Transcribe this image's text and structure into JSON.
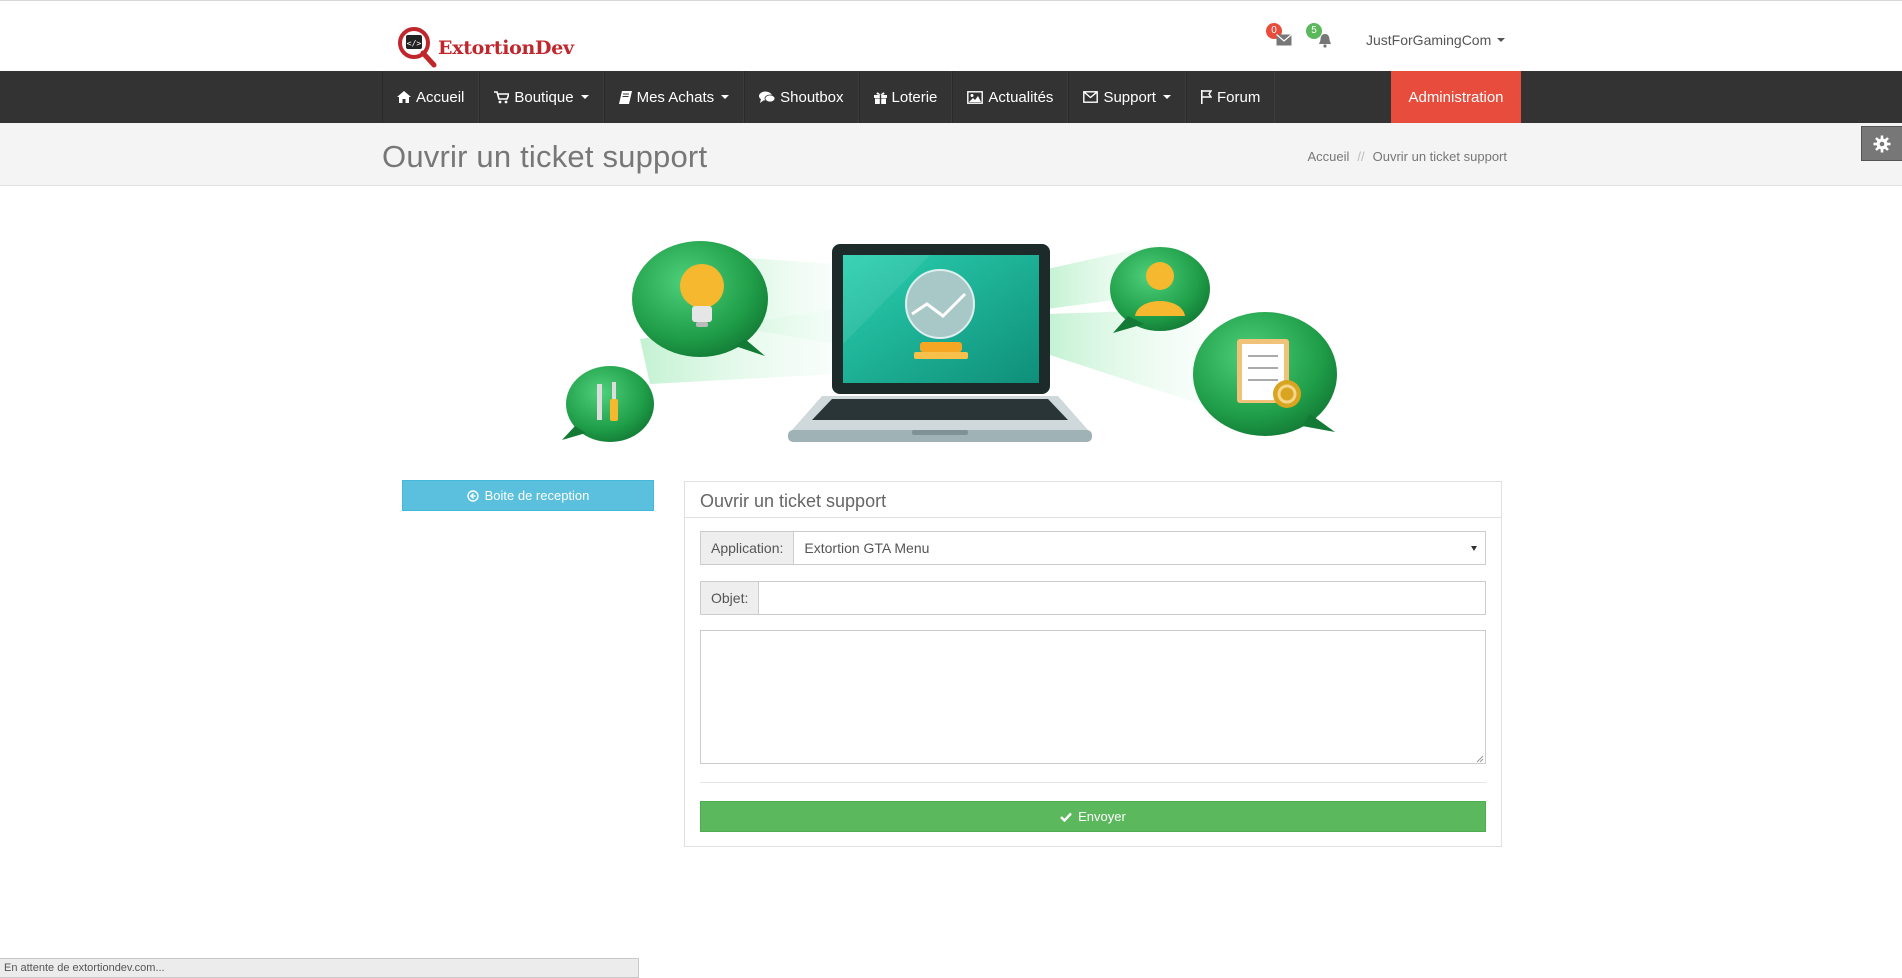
{
  "brand": {
    "name": "ExtortionDev",
    "accent": "#c0272d"
  },
  "header": {
    "mail_count": "0",
    "notif_count": "5",
    "user_name": "JustForGamingCom"
  },
  "nav": {
    "items": [
      {
        "label": "Accueil",
        "icon": "home-icon"
      },
      {
        "label": "Boutique",
        "icon": "cart-icon"
      },
      {
        "label": "Mes Achats",
        "icon": "book-icon"
      },
      {
        "label": "Shoutbox",
        "icon": "comments-icon"
      },
      {
        "label": "Loterie",
        "icon": "gift-icon"
      },
      {
        "label": "Actualités",
        "icon": "picture-icon"
      },
      {
        "label": "Support",
        "icon": "envelope-icon"
      },
      {
        "label": "Forum",
        "icon": "flag-icon"
      }
    ],
    "admin_label": "Administration",
    "admin_color": "#e74c3c"
  },
  "page": {
    "title": "Ouvrir un ticket support",
    "breadcrumb": {
      "home": "Accueil",
      "separator": "//",
      "current": "Ouvrir un ticket support"
    }
  },
  "sidebar": {
    "inbox_label": "Boite de reception"
  },
  "form": {
    "panel_title": "Ouvrir un ticket support",
    "application_label": "Application:",
    "application_value": "Extortion GTA Menu",
    "subject_label": "Objet:",
    "subject_value": "",
    "message_value": "",
    "submit_label": "Envoyer"
  },
  "status_bar": {
    "text": "En attente de extortiondev.com..."
  }
}
